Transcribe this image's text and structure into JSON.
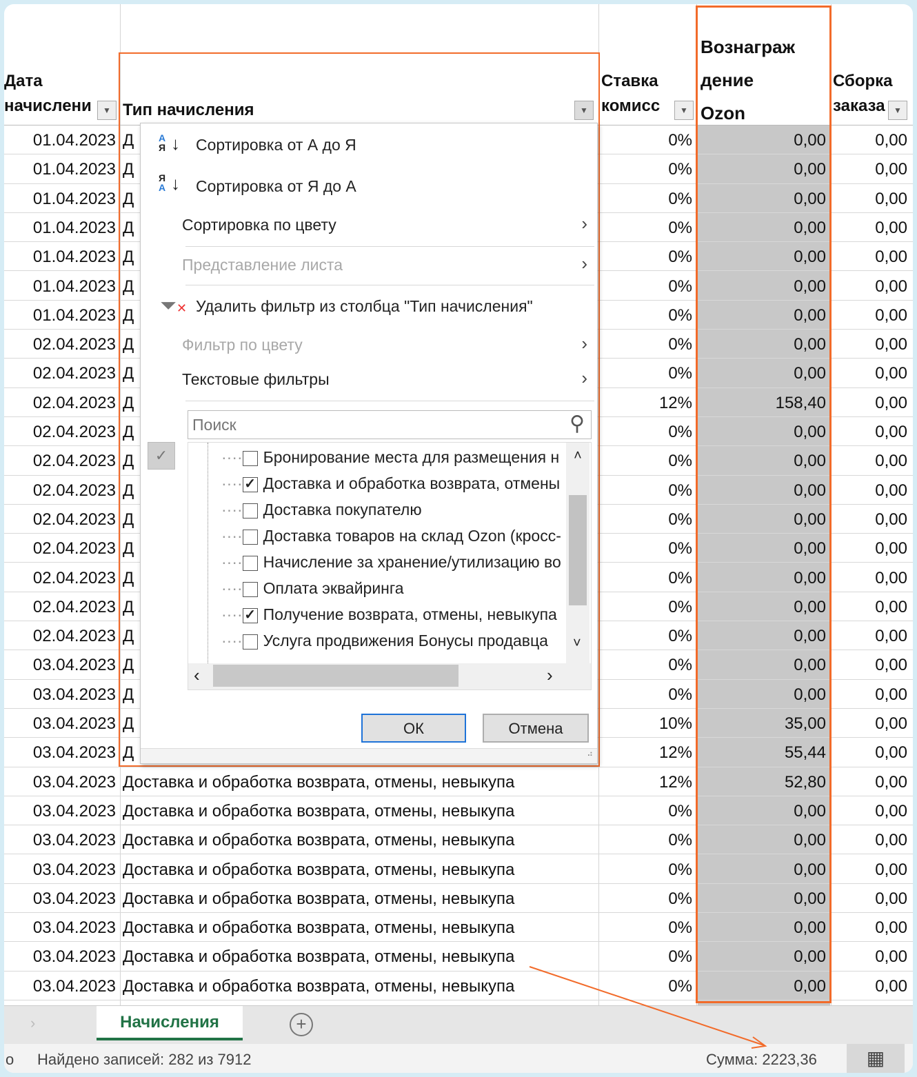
{
  "headers": {
    "date": [
      "Дата",
      "начислени"
    ],
    "type": "Тип начисления",
    "rate": [
      "Ставка",
      "комисс"
    ],
    "reward": [
      "Вознаграж",
      "дение",
      "Ozon"
    ],
    "assembly": [
      "Сборка",
      "заказа"
    ]
  },
  "rows": [
    {
      "date": "01.04.2023",
      "type": "Д",
      "rate": "0%",
      "reward": "0,00",
      "assembly": "0,00"
    },
    {
      "date": "01.04.2023",
      "type": "Д",
      "rate": "0%",
      "reward": "0,00",
      "assembly": "0,00"
    },
    {
      "date": "01.04.2023",
      "type": "Д",
      "rate": "0%",
      "reward": "0,00",
      "assembly": "0,00"
    },
    {
      "date": "01.04.2023",
      "type": "Д",
      "rate": "0%",
      "reward": "0,00",
      "assembly": "0,00"
    },
    {
      "date": "01.04.2023",
      "type": "Д",
      "rate": "0%",
      "reward": "0,00",
      "assembly": "0,00"
    },
    {
      "date": "01.04.2023",
      "type": "Д",
      "rate": "0%",
      "reward": "0,00",
      "assembly": "0,00"
    },
    {
      "date": "01.04.2023",
      "type": "Д",
      "rate": "0%",
      "reward": "0,00",
      "assembly": "0,00"
    },
    {
      "date": "02.04.2023",
      "type": "Д",
      "rate": "0%",
      "reward": "0,00",
      "assembly": "0,00"
    },
    {
      "date": "02.04.2023",
      "type": "Д",
      "rate": "0%",
      "reward": "0,00",
      "assembly": "0,00"
    },
    {
      "date": "02.04.2023",
      "type": "Д",
      "rate": "12%",
      "reward": "158,40",
      "assembly": "0,00"
    },
    {
      "date": "02.04.2023",
      "type": "Д",
      "rate": "0%",
      "reward": "0,00",
      "assembly": "0,00"
    },
    {
      "date": "02.04.2023",
      "type": "Д",
      "rate": "0%",
      "reward": "0,00",
      "assembly": "0,00"
    },
    {
      "date": "02.04.2023",
      "type": "Д",
      "rate": "0%",
      "reward": "0,00",
      "assembly": "0,00"
    },
    {
      "date": "02.04.2023",
      "type": "Д",
      "rate": "0%",
      "reward": "0,00",
      "assembly": "0,00"
    },
    {
      "date": "02.04.2023",
      "type": "Д",
      "rate": "0%",
      "reward": "0,00",
      "assembly": "0,00"
    },
    {
      "date": "02.04.2023",
      "type": "Д",
      "rate": "0%",
      "reward": "0,00",
      "assembly": "0,00"
    },
    {
      "date": "02.04.2023",
      "type": "Д",
      "rate": "0%",
      "reward": "0,00",
      "assembly": "0,00"
    },
    {
      "date": "02.04.2023",
      "type": "Д",
      "rate": "0%",
      "reward": "0,00",
      "assembly": "0,00"
    },
    {
      "date": "03.04.2023",
      "type": "Д",
      "rate": "0%",
      "reward": "0,00",
      "assembly": "0,00"
    },
    {
      "date": "03.04.2023",
      "type": "Д",
      "rate": "0%",
      "reward": "0,00",
      "assembly": "0,00"
    },
    {
      "date": "03.04.2023",
      "type": "Д",
      "rate": "10%",
      "reward": "35,00",
      "assembly": "0,00"
    },
    {
      "date": "03.04.2023",
      "type": "Д",
      "rate": "12%",
      "reward": "55,44",
      "assembly": "0,00"
    },
    {
      "date": "03.04.2023",
      "type": "Доставка и обработка возврата, отмены, невыкупа",
      "rate": "12%",
      "reward": "52,80",
      "assembly": "0,00"
    },
    {
      "date": "03.04.2023",
      "type": "Доставка и обработка возврата, отмены, невыкупа",
      "rate": "0%",
      "reward": "0,00",
      "assembly": "0,00"
    },
    {
      "date": "03.04.2023",
      "type": "Доставка и обработка возврата, отмены, невыкупа",
      "rate": "0%",
      "reward": "0,00",
      "assembly": "0,00"
    },
    {
      "date": "03.04.2023",
      "type": "Доставка и обработка возврата, отмены, невыкупа",
      "rate": "0%",
      "reward": "0,00",
      "assembly": "0,00"
    },
    {
      "date": "03.04.2023",
      "type": "Доставка и обработка возврата, отмены, невыкупа",
      "rate": "0%",
      "reward": "0,00",
      "assembly": "0,00"
    },
    {
      "date": "03.04.2023",
      "type": "Доставка и обработка возврата, отмены, невыкупа",
      "rate": "0%",
      "reward": "0,00",
      "assembly": "0,00"
    },
    {
      "date": "03.04.2023",
      "type": "Доставка и обработка возврата, отмены, невыкупа",
      "rate": "0%",
      "reward": "0,00",
      "assembly": "0,00"
    },
    {
      "date": "03.04.2023",
      "type": "Доставка и обработка возврата, отмены, невыкупа",
      "rate": "0%",
      "reward": "0,00",
      "assembly": "0,00"
    }
  ],
  "menu": {
    "sort_az": "Сортировка от А до Я",
    "sort_za": "Сортировка от Я до А",
    "sort_color": "Сортировка по цвету",
    "sheet_view": "Представление листа",
    "clear_filter": "Удалить фильтр из столбца \"Тип начисления\"",
    "filter_color": "Фильтр по цвету",
    "text_filters": "Текстовые фильтры",
    "search_placeholder": "Поиск",
    "items": [
      {
        "label": "Бронирование места для размещения н",
        "checked": false
      },
      {
        "label": "Доставка и обработка возврата, отмены",
        "checked": true
      },
      {
        "label": "Доставка покупателю",
        "checked": false
      },
      {
        "label": "Доставка товаров на склад Ozon (кросс-",
        "checked": false
      },
      {
        "label": "Начисление за хранение/утилизацию во",
        "checked": false
      },
      {
        "label": "Оплата эквайринга",
        "checked": false
      },
      {
        "label": "Получение возврата, отмены, невыкупа",
        "checked": true
      },
      {
        "label": "Услуга продвижения Бонусы продавца",
        "checked": false
      }
    ],
    "ok": "ОК",
    "cancel": "Отмена"
  },
  "sheet_tab": "Начисления",
  "status": {
    "records": "Найдено записей: 282 из 7912",
    "sum": "Сумма: 2223,36",
    "left": "о"
  },
  "colors": {
    "highlight": "#f26b2a",
    "selected": "#c8c8c8",
    "tab_green": "#217346"
  }
}
